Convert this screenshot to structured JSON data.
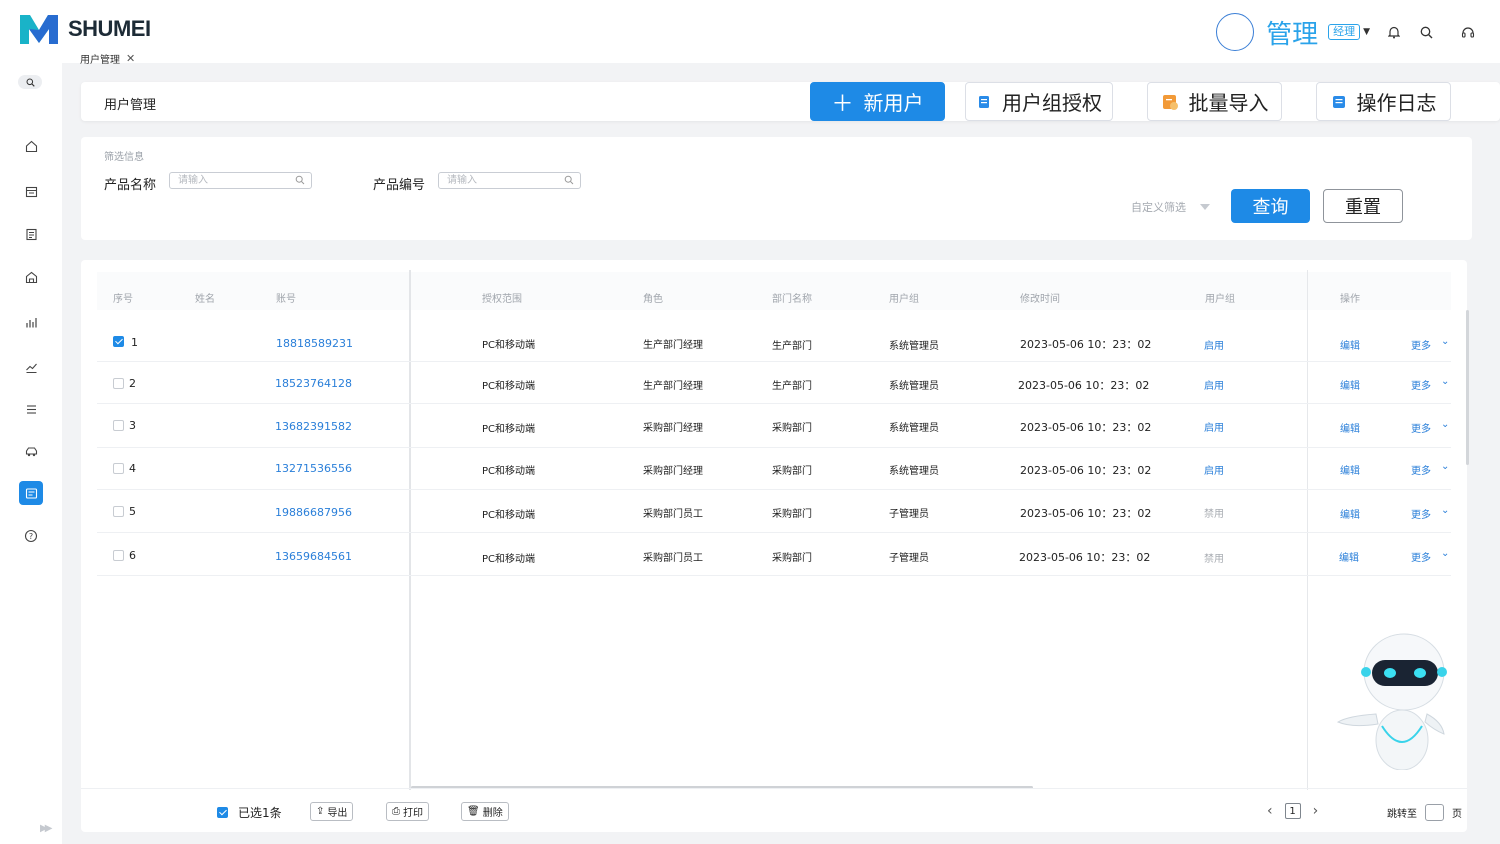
{
  "app": {
    "brand": "SHUMEI"
  },
  "user": {
    "name": "管理",
    "role": "经理"
  },
  "colors": {
    "primary": "#1e8ae6",
    "link": "#2a7fd9",
    "brand_teal": "#19b3c8"
  },
  "sidebar": {
    "items": [
      {
        "icon": "home-icon"
      },
      {
        "icon": "calendar-icon"
      },
      {
        "icon": "document-icon"
      },
      {
        "icon": "store-icon"
      },
      {
        "icon": "chart-icon"
      },
      {
        "icon": "trend-icon"
      },
      {
        "icon": "list-icon"
      },
      {
        "icon": "car-icon"
      },
      {
        "icon": "user-management-icon",
        "active": true
      },
      {
        "icon": "help-icon"
      }
    ]
  },
  "tabs": [
    {
      "label": "用户管理"
    }
  ],
  "header": {
    "title": "用户管理",
    "buttons": {
      "new_user": "新用户",
      "group_auth": "用户组授权",
      "batch_import": "批量导入",
      "op_log": "操作日志"
    }
  },
  "filter": {
    "section": "筛选信息",
    "product_name_label": "产品名称",
    "product_code_label": "产品编号",
    "placeholder": "请输入",
    "custom": "自定义筛选",
    "query": "查询",
    "reset": "重置"
  },
  "table": {
    "columns": [
      "序号",
      "姓名",
      "账号",
      "授权范围",
      "角色",
      "部门名称",
      "用户组",
      "修改时间",
      "用户组",
      "操作"
    ],
    "rows": [
      {
        "no": "1",
        "name": "",
        "account": "18818589231",
        "scope": "PC和移动端",
        "role": "生产部门经理",
        "dept": "生产部门",
        "group": "系统管理员",
        "time": "2023-05-06 10：23：02",
        "status": "启用",
        "edit": "编辑",
        "more": "更多",
        "checked": true
      },
      {
        "no": "2",
        "name": "",
        "account": "18523764128",
        "scope": "PC和移动端",
        "role": "生产部门经理",
        "dept": "生产部门",
        "group": "系统管理员",
        "time": "2023-05-06 10：23：02",
        "status": "启用",
        "edit": "编辑",
        "more": "更多",
        "checked": false
      },
      {
        "no": "3",
        "name": "",
        "account": "13682391582",
        "scope": "PC和移动端",
        "role": "采购部门经理",
        "dept": "采购部门",
        "group": "系统管理员",
        "time": "2023-05-06 10：23：02",
        "status": "启用",
        "edit": "编辑",
        "more": "更多",
        "checked": false
      },
      {
        "no": "4",
        "name": "",
        "account": "13271536556",
        "scope": "PC和移动端",
        "role": "采购部门经理",
        "dept": "采购部门",
        "group": "系统管理员",
        "time": "2023-05-06 10：23：02",
        "status": "启用",
        "edit": "编辑",
        "more": "更多",
        "checked": false
      },
      {
        "no": "5",
        "name": "",
        "account": "19886687956",
        "scope": "PC和移动端",
        "role": "采购部门员工",
        "dept": "采购部门",
        "group": "子管理员",
        "time": "2023-05-06 10：23：02",
        "status": "禁用",
        "edit": "编辑",
        "more": "更多",
        "checked": false
      },
      {
        "no": "6",
        "name": "",
        "account": "13659684561",
        "scope": "PC和移动端",
        "role": "采购部门员工",
        "dept": "采购部门",
        "group": "子管理员",
        "time": "2023-05-06 10：23：02",
        "status": "禁用",
        "edit": "编辑",
        "more": "更多",
        "checked": false
      }
    ]
  },
  "footer": {
    "selected": "已选1条",
    "export": "导出",
    "print": "打印",
    "delete": "删除",
    "page": "1",
    "jump_to": "跳转至",
    "page_unit": "页"
  }
}
